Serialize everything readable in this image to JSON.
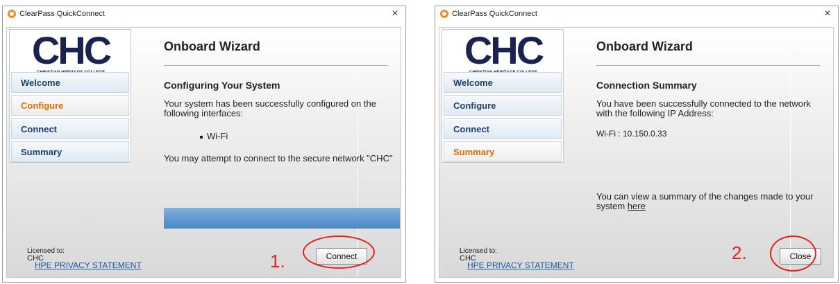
{
  "windows": [
    {
      "title": "ClearPass QuickConnect",
      "close_glyph": "×",
      "logo": {
        "main": "CHC",
        "sub": "CHRISTIAN HERITAGE COLLEGE"
      },
      "nav": [
        {
          "label": "Welcome",
          "active": false
        },
        {
          "label": "Configure",
          "active": true
        },
        {
          "label": "Connect",
          "active": false
        },
        {
          "label": "Summary",
          "active": false
        }
      ],
      "wizard_title": "Onboard Wizard",
      "section_title": "Configuring Your System",
      "body_text": "Your system has been successfully configured on the following interfaces:",
      "interface_item": "Wi-Fi",
      "attempt_text": "You may attempt to connect to the secure network \"CHC\"",
      "progress": 1.0,
      "licensed_label": "Licensed to:",
      "licensed_value": "CHC",
      "privacy_link": "HPE PRIVACY STATEMENT",
      "button_label": "Connect",
      "step_label": "1."
    },
    {
      "title": "ClearPass QuickConnect",
      "close_glyph": "×",
      "logo": {
        "main": "CHC",
        "sub": "CHRISTIAN HERITAGE COLLEGE"
      },
      "nav": [
        {
          "label": "Welcome",
          "active": false
        },
        {
          "label": "Configure",
          "active": false
        },
        {
          "label": "Connect",
          "active": false
        },
        {
          "label": "Summary",
          "active": true
        }
      ],
      "wizard_title": "Onboard Wizard",
      "section_title": "Connection Summary",
      "body_text": "You have been successfully connected to the network with the following IP Address:",
      "ip_line": "Wi-Fi : 10.150.0.33",
      "summary_text_prefix": "You can view a summary of the changes made to your system",
      "summary_link": "here",
      "licensed_label": "Licensed to:",
      "licensed_value": "CHC",
      "privacy_link": "HPE PRIVACY STATEMENT",
      "button_label": "Close",
      "step_label": "2."
    }
  ],
  "colors": {
    "accent_orange": "#e06a00",
    "nav_blue": "#1e3f6e",
    "progress_blue": "#5c98d0",
    "annotation_red": "#e02020",
    "link_blue": "#1a55a5"
  }
}
